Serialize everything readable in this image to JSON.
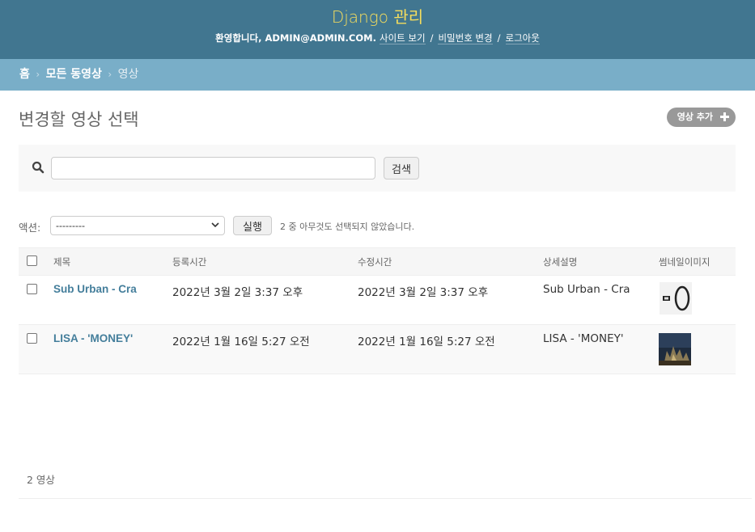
{
  "header": {
    "site_name": "Django 관리",
    "welcome": "환영합니다,",
    "user": "ADMIN@ADMIN.COM",
    "view_site": "사이트 보기",
    "change_password": "비밀번호 변경",
    "logout": "로그아웃"
  },
  "breadcrumbs": {
    "home": "홈",
    "app": "모든 동영상",
    "current": "영상"
  },
  "page": {
    "title": "변경할 영상 선택",
    "add_button": "영상 추가"
  },
  "search": {
    "value": "",
    "button": "검색"
  },
  "actions": {
    "label": "액션:",
    "selected": "---------",
    "run_button": "실행",
    "counter": "2 중 아무것도 선택되지 않았습니다."
  },
  "table": {
    "headers": [
      "제목",
      "등록시간",
      "수정시간",
      "상세설명",
      "썸네일이미지"
    ],
    "rows": [
      {
        "title": "Sub Urban - Cra",
        "created": "2022년 3월 2일 3:37 오후",
        "modified": "2022년 3월 2일 3:37 오후",
        "description": "Sub Urban - Cra",
        "thumbnail": "thumbnail-sub-urban"
      },
      {
        "title": "LISA - 'MONEY'",
        "created": "2022년 1월 16일 5:27 오전",
        "modified": "2022년 1월 16일 5:27 오전",
        "description": "LISA - 'MONEY'",
        "thumbnail": "thumbnail-lisa-money"
      }
    ]
  },
  "paginator": {
    "text": "2 영상"
  },
  "colors": {
    "header_bg": "#417690",
    "site_name": "#f5dd5d",
    "breadcrumbs_bg": "#79aec8",
    "link": "#447e9b",
    "add_button_bg": "#999999"
  }
}
